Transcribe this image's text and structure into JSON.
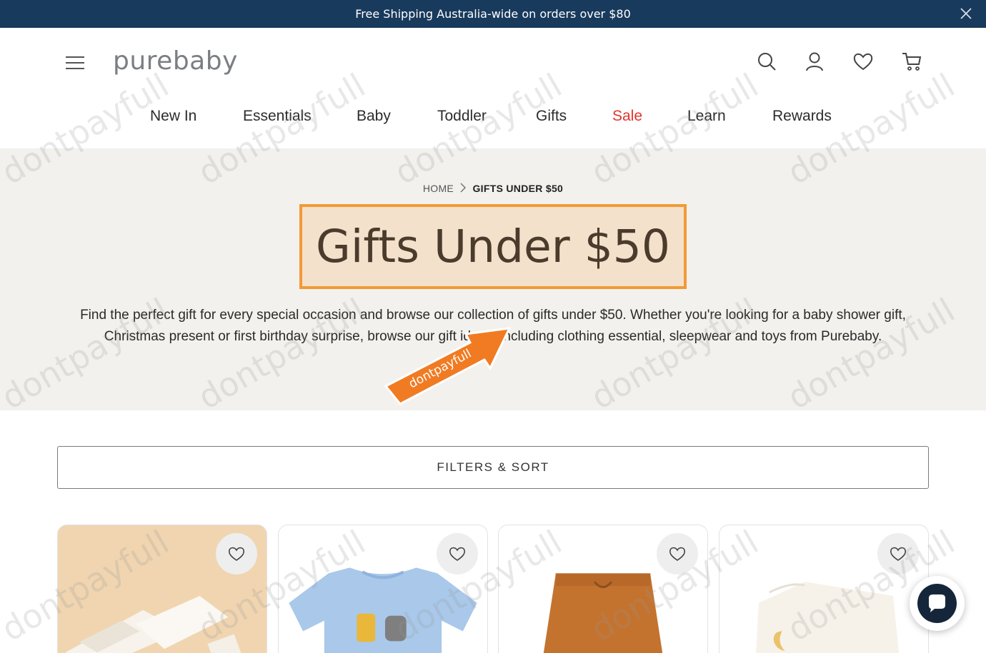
{
  "announcement": {
    "text": "Free Shipping Australia-wide on orders over $80"
  },
  "brand": {
    "logo_text": "purebaby"
  },
  "nav": {
    "items": [
      "New In",
      "Essentials",
      "Baby",
      "Toddler",
      "Gifts",
      "Sale",
      "Learn",
      "Rewards"
    ]
  },
  "breadcrumb": {
    "home": "HOME",
    "current": "GIFTS UNDER $50"
  },
  "hero": {
    "title": "Gifts Under $50",
    "description": "Find the perfect gift for every special occasion and browse our collection of gifts under $50. Whether you're looking for a baby shower gift, Christmas present or first birthday surprise, browse our gift ideas, including clothing essential, sleepwear and toys from Purebaby."
  },
  "annotation": {
    "arrow_label": "dontpayfull"
  },
  "filters": {
    "label": "FILTERS & SORT"
  },
  "watermark": {
    "text": "dontpayfull"
  },
  "colors": {
    "announce_bg": "#183a5c",
    "sale": "#e0342b",
    "hero_bg": "#f2f1ee",
    "highlight_border": "#f29a35",
    "highlight_fill": "#f4e1cb"
  },
  "icons": [
    "close-icon",
    "menu-icon",
    "search-icon",
    "account-icon",
    "wishlist-icon",
    "cart-icon",
    "chevron-right-icon",
    "heart-icon",
    "chat-icon"
  ]
}
